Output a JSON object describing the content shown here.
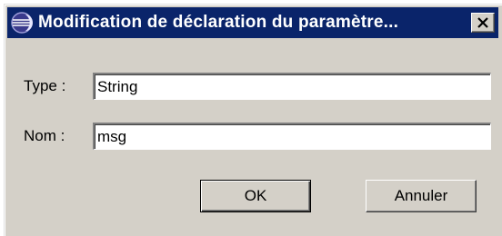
{
  "window": {
    "title": "Modification de déclaration du paramètre...",
    "close_icon": "close-x-icon",
    "app_icon": "eclipse-icon"
  },
  "form": {
    "type_label": "Type :",
    "type_value": "String",
    "name_label": "Nom :",
    "name_value": "msg"
  },
  "buttons": {
    "ok_label": "OK",
    "cancel_label": "Annuler"
  },
  "colors": {
    "titlebar": "#0a246a",
    "face": "#d4d0c8"
  }
}
